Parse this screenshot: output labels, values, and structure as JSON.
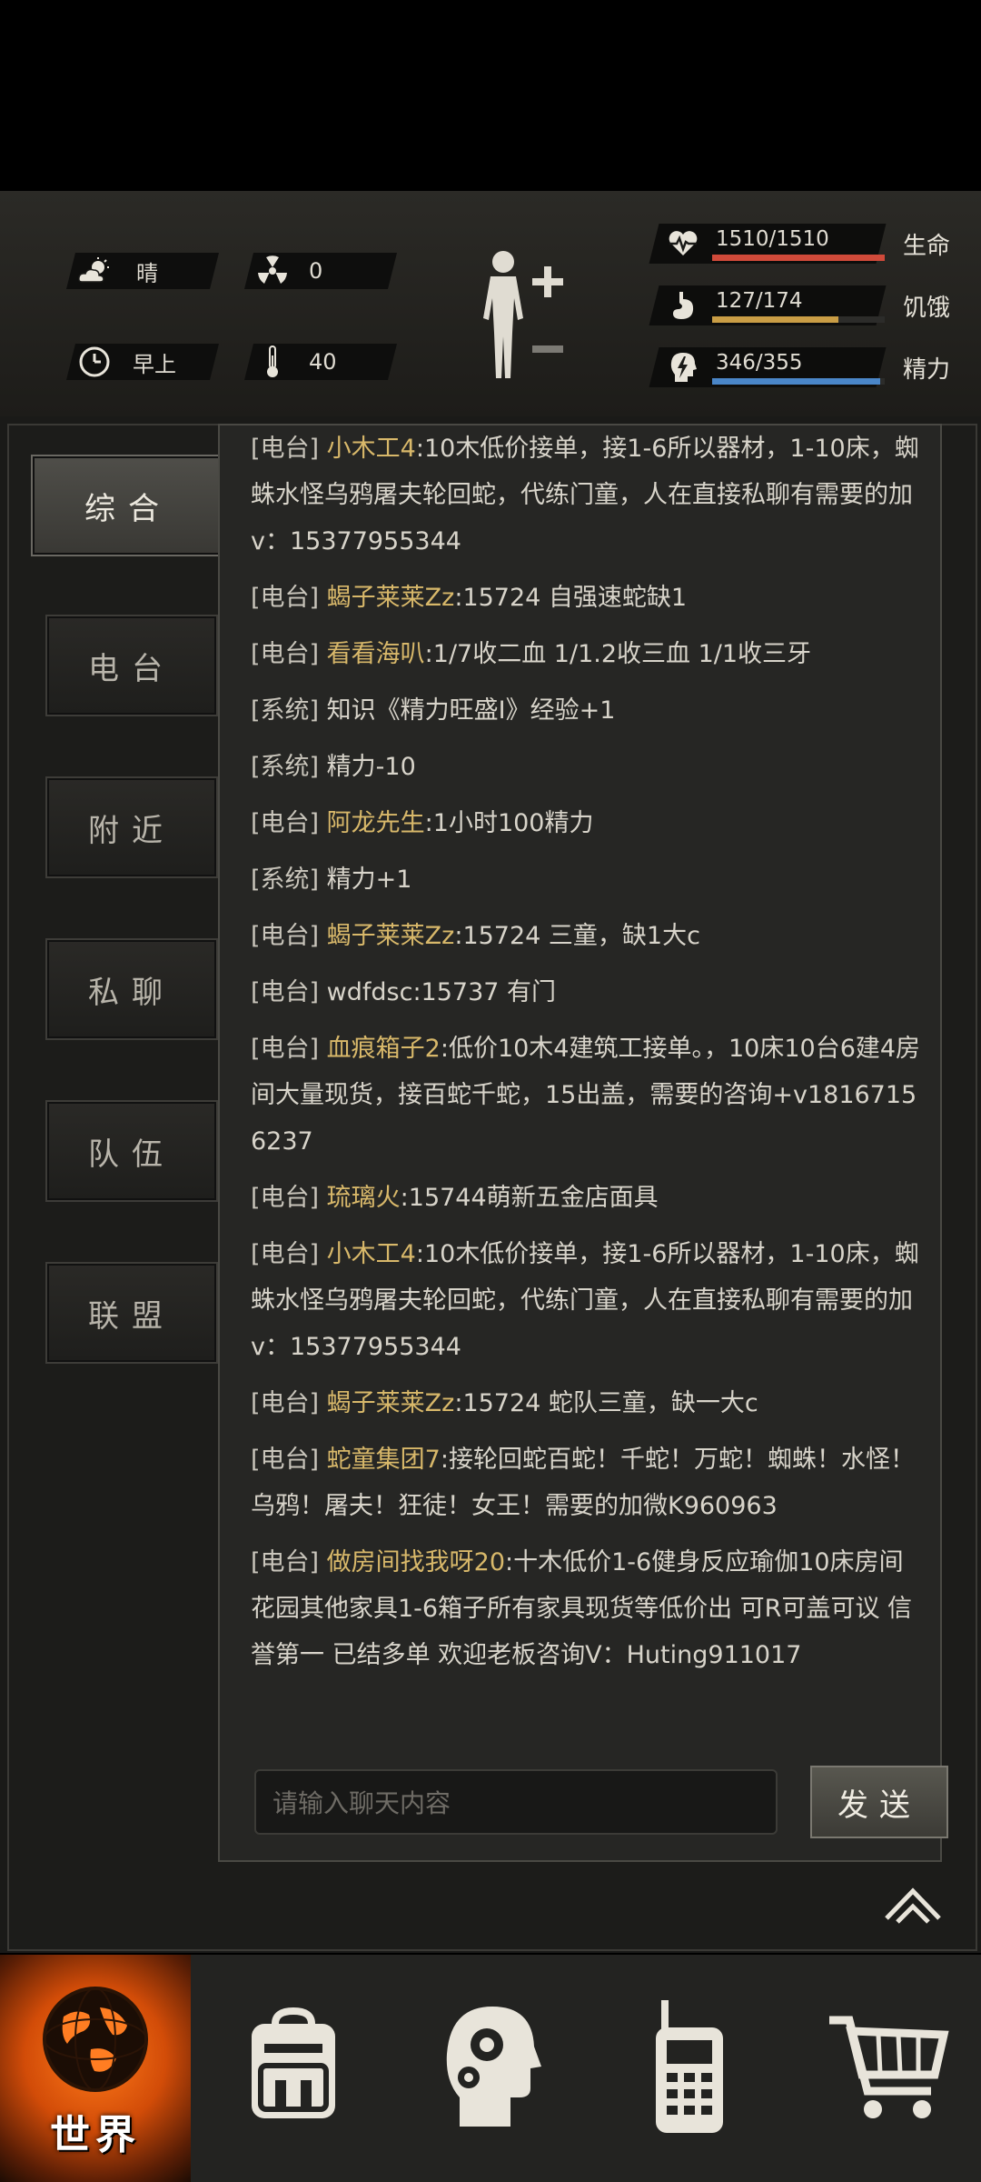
{
  "status": {
    "weather": {
      "icon": "cloud-sun-icon",
      "label": "晴"
    },
    "radiation": {
      "icon": "radiation-icon",
      "value": "0"
    },
    "time_of_day": {
      "icon": "clock-icon",
      "label": "早上"
    },
    "temperature": {
      "icon": "thermometer-icon",
      "value": "40"
    },
    "body_icon": "body-figure-icon",
    "health": {
      "value": "1510/1510",
      "label": "生命",
      "fraction": 1.0,
      "color": "#d04a3a"
    },
    "hunger": {
      "value": "127/174",
      "label": "饥饿",
      "fraction": 0.73,
      "color": "#c99d45"
    },
    "energy": {
      "value": "346/355",
      "label": "精力",
      "fraction": 0.975,
      "color": "#4a86c8"
    }
  },
  "sidebar": {
    "items": [
      {
        "label": "综合",
        "active": true
      },
      {
        "label": "电台",
        "active": false
      },
      {
        "label": "附近",
        "active": false
      },
      {
        "label": "私聊",
        "active": false
      },
      {
        "label": "队伍",
        "active": false
      },
      {
        "label": "联盟",
        "active": false
      }
    ]
  },
  "chat": {
    "messages": [
      {
        "channel": "[电台]",
        "name": "小木工4",
        "text": ":10木低价接单，接1-6所以器材，1-10床，蜘蛛水怪乌鸦屠夫轮回蛇，代练门童，人在直接私聊有需要的加v：15377955344"
      },
      {
        "channel": "[电台]",
        "name": "蝎子莱莱Zz",
        "text": ":15724 自强速蛇缺1"
      },
      {
        "channel": "[电台]",
        "name": "看看海叭",
        "text": ":1/7收二血 1/1.2收三血 1/1收三牙"
      },
      {
        "channel": "[系统]",
        "name": "",
        "text": "知识《精力旺盛Ⅰ》经验+1"
      },
      {
        "channel": "[系统]",
        "name": "",
        "text": "精力-10"
      },
      {
        "channel": "[电台]",
        "name": "阿龙先生",
        "text": ":1小时100精力"
      },
      {
        "channel": "[系统]",
        "name": "",
        "text": "精力+1"
      },
      {
        "channel": "[电台]",
        "name": "蝎子莱莱Zz",
        "text": ":15724 三童，缺1大c"
      },
      {
        "channel": "[电台]",
        "name": "",
        "text": "wdfdsc:15737 有门"
      },
      {
        "channel": "[电台]",
        "name": "血痕箱子2",
        "text": ":低价10木4建筑工接单。，10床10台6建4房间大量现货，接百蛇千蛇，15出盖，需要的咨询+v18167156237"
      },
      {
        "channel": "[电台]",
        "name": "琉璃火",
        "text": ":15744萌新五金店面具"
      },
      {
        "channel": "[电台]",
        "name": "小木工4",
        "text": ":10木低价接单，接1-6所以器材，1-10床，蜘蛛水怪乌鸦屠夫轮回蛇，代练门童，人在直接私聊有需要的加v：15377955344"
      },
      {
        "channel": "[电台]",
        "name": "蝎子莱莱Zz",
        "text": ":15724 蛇队三童，缺一大c"
      },
      {
        "channel": "[电台]",
        "name": "蛇童集团7",
        "text": ":接轮回蛇百蛇！千蛇！万蛇！蜘蛛！水怪！乌鸦！屠夫！狂徒！女王！需要的加微K960963"
      },
      {
        "channel": "[电台]",
        "name": "做房间找我呀20",
        "text": ":十木低价1-6健身反应瑜伽10床房间花园其他家具1-6箱子所有家具现货等低价出 可R可盖可议 信誉第一 已结多单 欢迎老板咨询V：Huting911017"
      }
    ],
    "input_placeholder": "请输入聊天内容",
    "send_label": "发送",
    "collapse_icon": "double-chevron-up-icon"
  },
  "bottom_nav": {
    "items": [
      {
        "icon": "globe-icon",
        "label": "世界",
        "active": true
      },
      {
        "icon": "backpack-icon",
        "label": ""
      },
      {
        "icon": "head-gears-icon",
        "label": ""
      },
      {
        "icon": "walkie-talkie-icon",
        "label": ""
      },
      {
        "icon": "shopping-cart-icon",
        "label": ""
      }
    ]
  }
}
